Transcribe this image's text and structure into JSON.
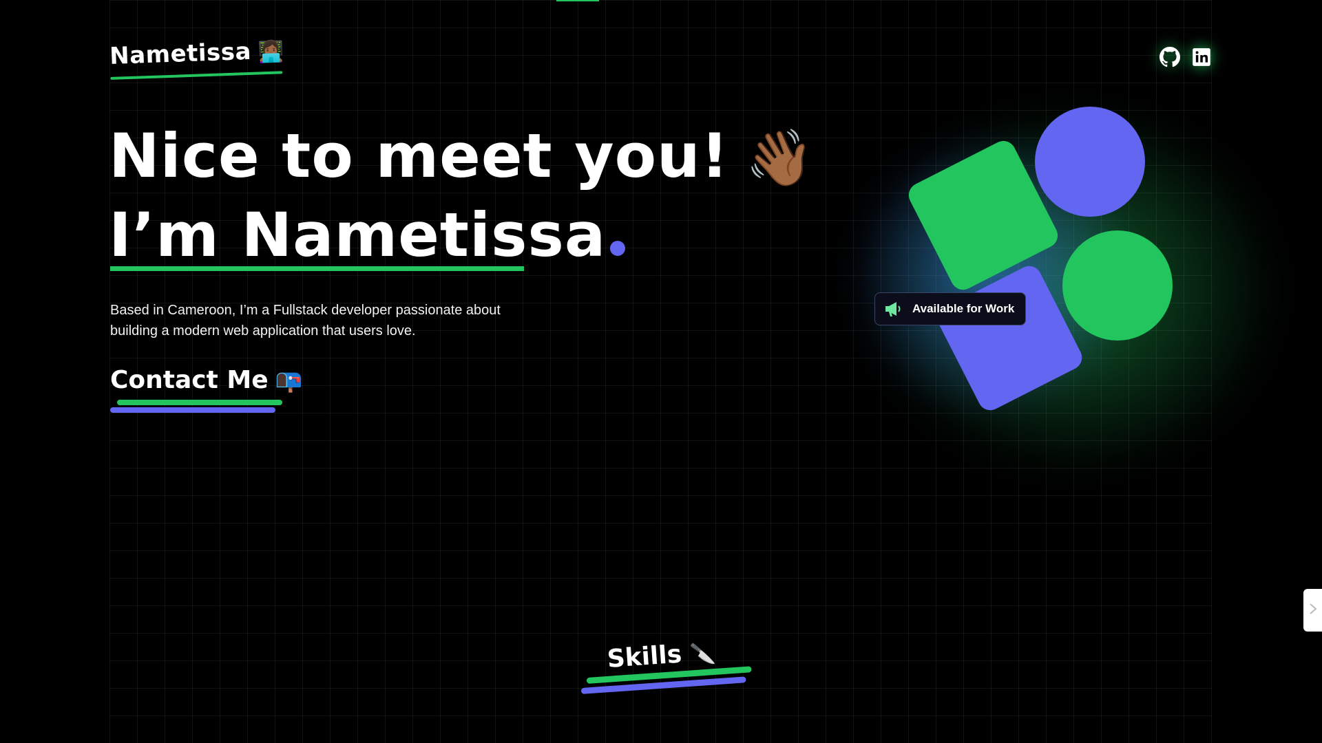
{
  "header": {
    "logo_text": "Nametissa",
    "logo_emoji": "👩🏾‍💻",
    "social_icons": [
      "github-icon",
      "linkedin-icon"
    ]
  },
  "hero": {
    "line1": "Nice to meet you!",
    "wave_emoji": "👋🏾",
    "line2": "I’m Nametissa",
    "bio": "Based in Cameroon, I’m a Fullstack developer passionate about building a modern web application that users love.",
    "contact_label": "Contact Me",
    "contact_emoji": "📭"
  },
  "badge": {
    "icon": "megaphone-icon",
    "label": "Available for Work"
  },
  "skills": {
    "title": "Skills",
    "emoji": "🔪"
  },
  "colors": {
    "accent_green": "#22c55e",
    "accent_blue": "#6366f1",
    "background": "#000000"
  }
}
